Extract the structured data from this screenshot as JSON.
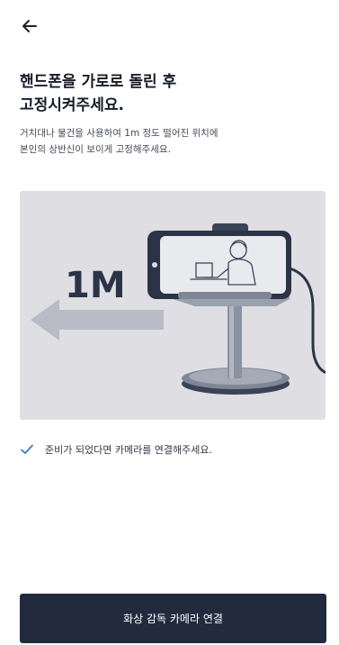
{
  "header": {
    "back_icon": "arrow-left-icon"
  },
  "title": {
    "line1": "핸드폰을 가로로 돌린 후",
    "line2": "고정시켜주세요."
  },
  "description": {
    "line1": "거치대나 물건을 사용하여 1m 정도 떨어진 위치에",
    "line2": "본인의 상반신이 보이게 고정해주세요."
  },
  "illustration": {
    "distance_label": "1M",
    "arrow_icon": "arrow-left-icon",
    "stand_icon": "phone-stand-icon"
  },
  "checklist": {
    "icon": "check-icon",
    "label": "준비가 되었다면 카메라를 연결해주세요.",
    "check_color": "#2f7be6"
  },
  "cta": {
    "label": "화상 감독 카메라 연결",
    "background": "#222b3d"
  }
}
